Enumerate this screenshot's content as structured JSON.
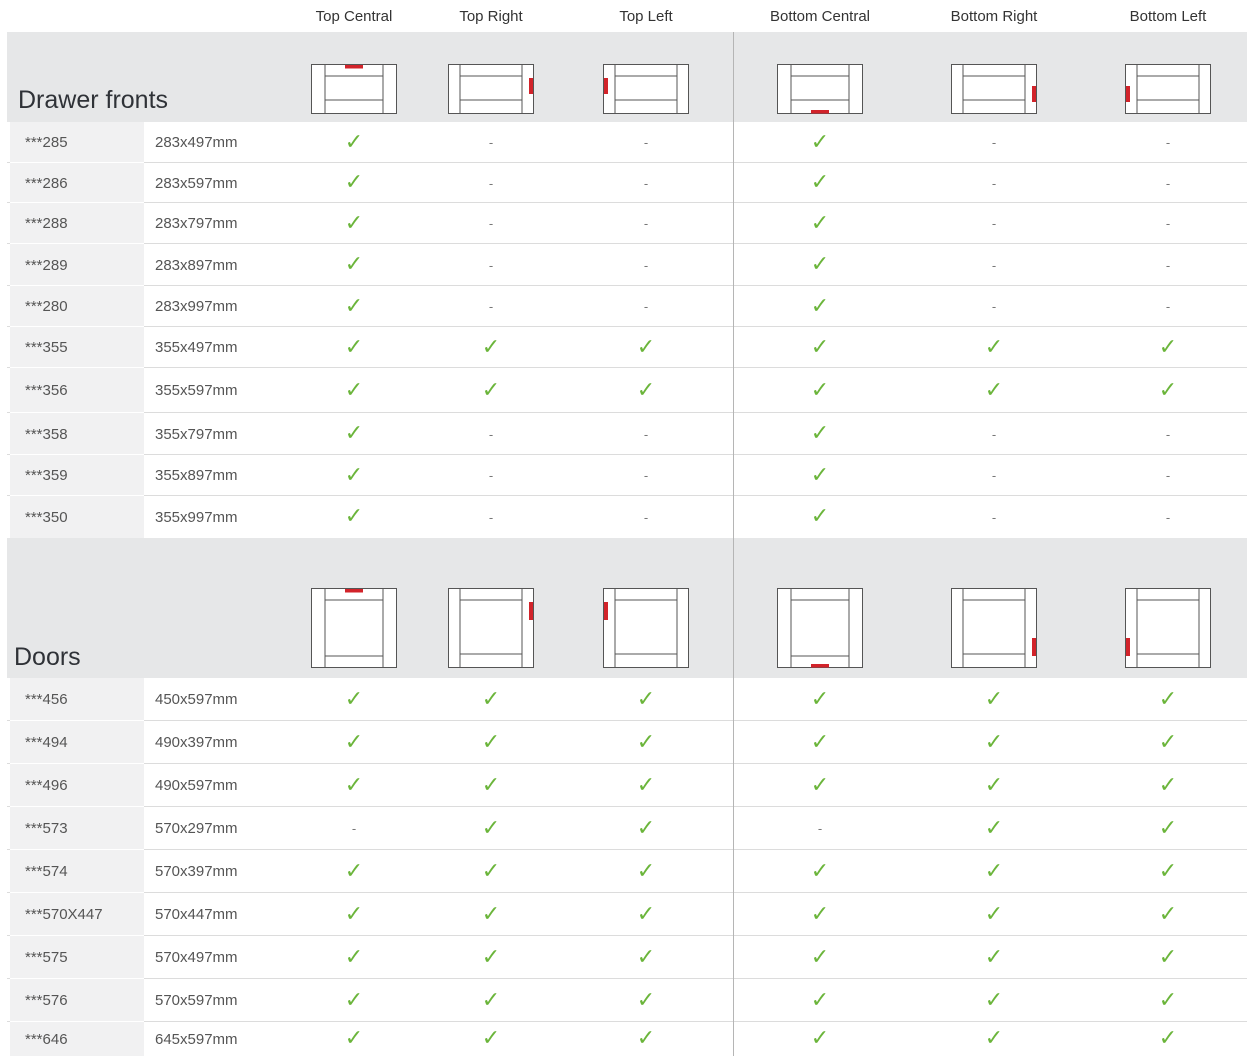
{
  "columns": [
    "Top Central",
    "Top Right",
    "Top Left",
    "Bottom Central",
    "Bottom Right",
    "Bottom Left"
  ],
  "icon_names": [
    "top-central-handle-icon",
    "top-right-handle-icon",
    "top-left-handle-icon",
    "bottom-central-handle-icon",
    "bottom-right-handle-icon",
    "bottom-left-handle-icon"
  ],
  "colors": {
    "check": "#6bb53b",
    "handle": "#d2232a",
    "band": "#e6e7e8"
  },
  "sections": [
    {
      "title": "Drawer fronts",
      "rows": [
        {
          "code": "***285",
          "size": "283x497mm",
          "marks": [
            "✓",
            "-",
            "-",
            "✓",
            "-",
            "-"
          ]
        },
        {
          "code": "***286",
          "size": "283x597mm",
          "marks": [
            "✓",
            "-",
            "-",
            "✓",
            "-",
            "-"
          ]
        },
        {
          "code": "***288",
          "size": "283x797mm",
          "marks": [
            "✓",
            "-",
            "-",
            "✓",
            "-",
            "-"
          ]
        },
        {
          "code": "***289",
          "size": "283x897mm",
          "marks": [
            "✓",
            "-",
            "-",
            "✓",
            "-",
            "-"
          ]
        },
        {
          "code": "***280",
          "size": "283x997mm",
          "marks": [
            "✓",
            "-",
            "-",
            "✓",
            "-",
            "-"
          ]
        },
        {
          "code": "***355",
          "size": "355x497mm",
          "marks": [
            "✓",
            "✓",
            "✓",
            "✓",
            "✓",
            "✓"
          ]
        },
        {
          "code": "***356",
          "size": "355x597mm",
          "marks": [
            "✓",
            "✓",
            "✓",
            "✓",
            "✓",
            "✓"
          ]
        },
        {
          "code": "***358",
          "size": "355x797mm",
          "marks": [
            "✓",
            "-",
            "-",
            "✓",
            "-",
            "-"
          ]
        },
        {
          "code": "***359",
          "size": "355x897mm",
          "marks": [
            "✓",
            "-",
            "-",
            "✓",
            "-",
            "-"
          ]
        },
        {
          "code": "***350",
          "size": "355x997mm",
          "marks": [
            "✓",
            "-",
            "-",
            "✓",
            "-",
            "-"
          ]
        }
      ]
    },
    {
      "title": "Doors",
      "rows": [
        {
          "code": "***456",
          "size": "450x597mm",
          "marks": [
            "✓",
            "✓",
            "✓",
            "✓",
            "✓",
            "✓"
          ]
        },
        {
          "code": "***494",
          "size": "490x397mm",
          "marks": [
            "✓",
            "✓",
            "✓",
            "✓",
            "✓",
            "✓"
          ]
        },
        {
          "code": "***496",
          "size": "490x597mm",
          "marks": [
            "✓",
            "✓",
            "✓",
            "✓",
            "✓",
            "✓"
          ]
        },
        {
          "code": "***573",
          "size": "570x297mm",
          "marks": [
            "-",
            "✓",
            "✓",
            "-",
            "✓",
            "✓"
          ]
        },
        {
          "code": "***574",
          "size": "570x397mm",
          "marks": [
            "✓",
            "✓",
            "✓",
            "✓",
            "✓",
            "✓"
          ]
        },
        {
          "code": "***570X447",
          "size": "570x447mm",
          "marks": [
            "✓",
            "✓",
            "✓",
            "✓",
            "✓",
            "✓"
          ]
        },
        {
          "code": "***575",
          "size": "570x497mm",
          "marks": [
            "✓",
            "✓",
            "✓",
            "✓",
            "✓",
            "✓"
          ]
        },
        {
          "code": "***576",
          "size": "570x597mm",
          "marks": [
            "✓",
            "✓",
            "✓",
            "✓",
            "✓",
            "✓"
          ]
        },
        {
          "code": "***646",
          "size": "645x597mm",
          "marks": [
            "✓",
            "✓",
            "✓",
            "✓",
            "✓",
            "✓"
          ]
        }
      ]
    }
  ]
}
